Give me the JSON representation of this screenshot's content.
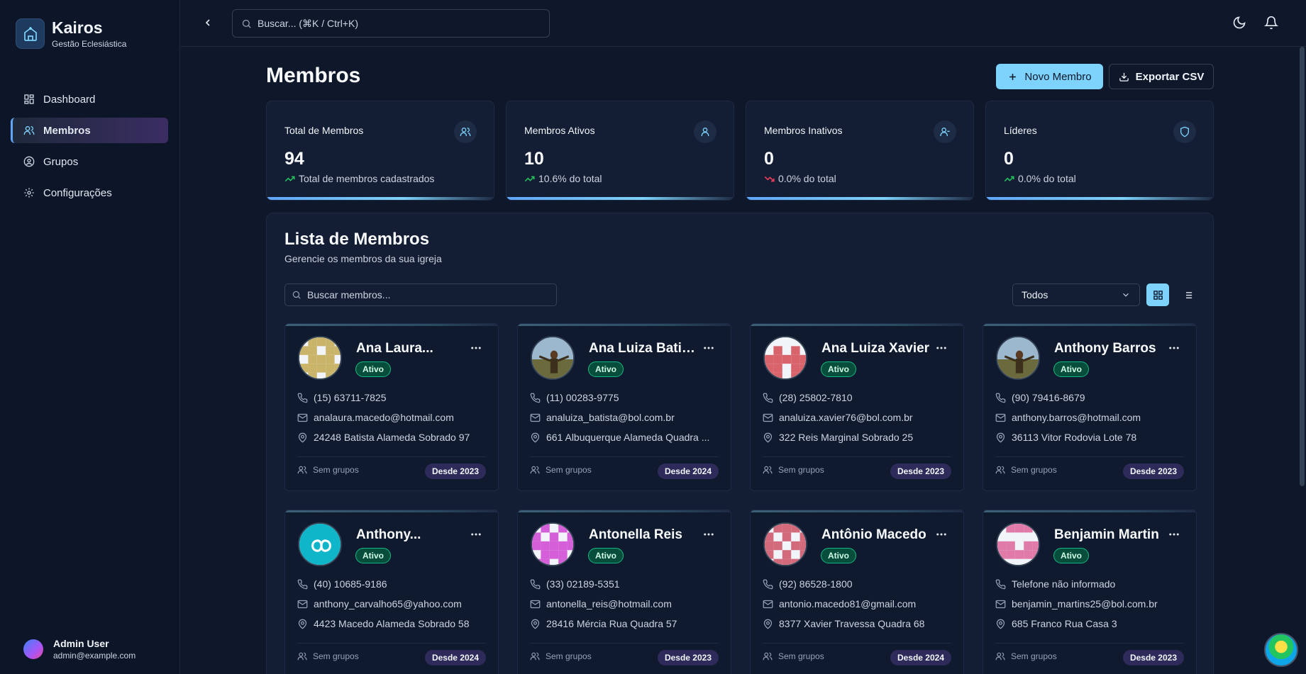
{
  "brand": {
    "name": "Kairos",
    "subtitle": "Gestão Eclesiástica"
  },
  "sidebar": {
    "items": [
      {
        "label": "Dashboard",
        "icon": "dashboard-icon"
      },
      {
        "label": "Membros",
        "icon": "users-icon",
        "active": true
      },
      {
        "label": "Grupos",
        "icon": "user-circle-icon"
      },
      {
        "label": "Configurações",
        "icon": "gear-icon"
      }
    ]
  },
  "user": {
    "name": "Admin User",
    "email": "admin@example.com"
  },
  "topbar": {
    "search_placeholder": "Buscar... (⌘K / Ctrl+K)"
  },
  "page": {
    "title": "Membros",
    "new_button": "Novo Membro",
    "export_button": "Exportar CSV"
  },
  "stats": [
    {
      "label": "Total de Membros",
      "value": "94",
      "sub": "Total de membros cadastrados",
      "trend": "up",
      "icon": "users-icon"
    },
    {
      "label": "Membros Ativos",
      "value": "10",
      "sub": "10.6% do total",
      "trend": "up",
      "icon": "user-icon"
    },
    {
      "label": "Membros Inativos",
      "value": "0",
      "sub": "0.0% do total",
      "trend": "down",
      "icon": "user-minus-icon"
    },
    {
      "label": "Líderes",
      "value": "0",
      "sub": "0.0% do total",
      "trend": "up",
      "icon": "shield-icon"
    }
  ],
  "list": {
    "title": "Lista de Membros",
    "subtitle": "Gerencie os membros da sua igreja",
    "search_placeholder": "Buscar membros...",
    "filter_value": "Todos"
  },
  "colors": {
    "accent": "#7dd3fc",
    "active_badge": "#064e3b",
    "trend_up": "#22c55e",
    "trend_down": "#f43f5e"
  },
  "members": [
    {
      "name": "Ana Laura...",
      "status": "Ativo",
      "phone": "(15) 63711-7825",
      "email": "analaura.macedo@hotmail.com",
      "address": "24248 Batista Alameda Sobrado 97",
      "groups": "Sem grupos",
      "since": "Desde 2023",
      "avatar": "identicon-gold"
    },
    {
      "name": "Ana Luiza Batista",
      "status": "Ativo",
      "phone": "(11) 00283-9775",
      "email": "analuiza_batista@bol.com.br",
      "address": "661 Albuquerque Alameda Quadra ...",
      "groups": "Sem grupos",
      "since": "Desde 2024",
      "avatar": "photo"
    },
    {
      "name": "Ana Luiza Xavier",
      "status": "Ativo",
      "phone": "(28) 25802-7810",
      "email": "analuiza.xavier76@bol.com.br",
      "address": "322 Reis Marginal Sobrado 25",
      "groups": "Sem grupos",
      "since": "Desde 2023",
      "avatar": "identicon-red"
    },
    {
      "name": "Anthony Barros",
      "status": "Ativo",
      "phone": "(90) 79416-8679",
      "email": "anthony.barros@hotmail.com",
      "address": "36113 Vitor Rodovia Lote 78",
      "groups": "Sem grupos",
      "since": "Desde 2023",
      "avatar": "photo"
    },
    {
      "name": "Anthony...",
      "status": "Ativo",
      "phone": "(40) 10685-9186",
      "email": "anthony_carvalho65@yahoo.com",
      "address": "4423 Macedo Alameda Sobrado 58",
      "groups": "Sem grupos",
      "since": "Desde 2024",
      "avatar": "infinity-teal"
    },
    {
      "name": "Antonella Reis",
      "status": "Ativo",
      "phone": "(33) 02189-5351",
      "email": "antonella_reis@hotmail.com",
      "address": "28416 Mércia Rua Quadra 57",
      "groups": "Sem grupos",
      "since": "Desde 2023",
      "avatar": "identicon-magenta"
    },
    {
      "name": "Antônio Macedo",
      "status": "Ativo",
      "phone": "(92) 86528-1800",
      "email": "antonio.macedo81@gmail.com",
      "address": "8377 Xavier Travessa Quadra 68",
      "groups": "Sem grupos",
      "since": "Desde 2024",
      "avatar": "identicon-rose"
    },
    {
      "name": "Benjamin Martin",
      "status": "Ativo",
      "phone": "Telefone não informado",
      "email": "benjamin_martins25@bol.com.br",
      "address": "685 Franco Rua Casa 3",
      "groups": "Sem grupos",
      "since": "Desde 2023",
      "avatar": "identicon-pink"
    }
  ]
}
